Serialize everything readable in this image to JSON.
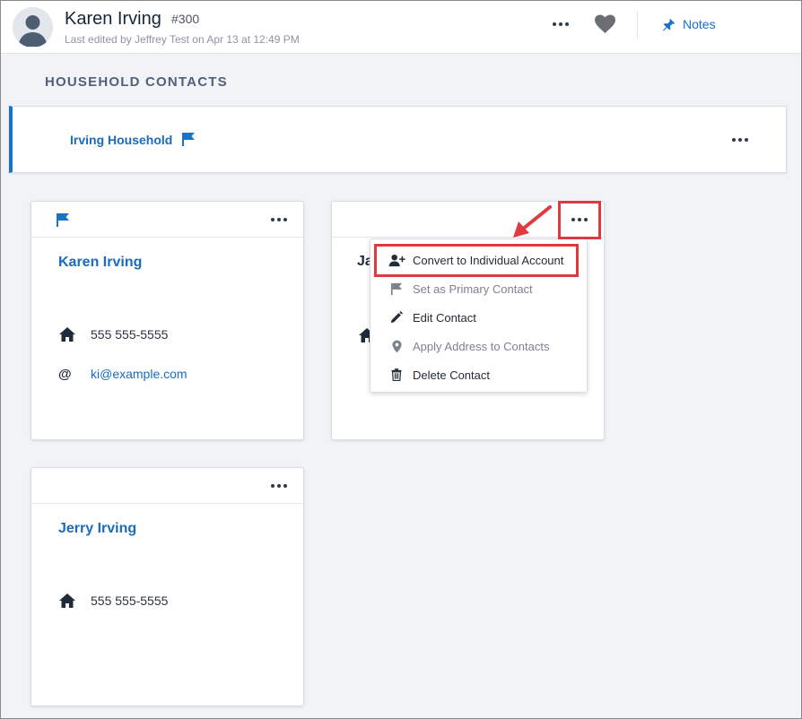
{
  "header": {
    "name": "Karen Irving",
    "record_id": "#300",
    "last_edited": "Last edited by Jeffrey Test on Apr 13 at 12:49 PM",
    "notes_label": "Notes"
  },
  "section_title": "HOUSEHOLD CONTACTS",
  "household": {
    "name": "Irving Household"
  },
  "cards": [
    {
      "name": "Karen Irving",
      "phone": "555 555-5555",
      "email": "ki@example.com"
    },
    {
      "name_partial": "Ja"
    },
    {
      "name": "Jerry Irving",
      "phone": "555 555-5555"
    }
  ],
  "menu": {
    "items": [
      {
        "label": "Convert to Individual Account",
        "icon": "person-add-icon",
        "enabled": true
      },
      {
        "label": "Set as Primary Contact",
        "icon": "flag-icon",
        "enabled": false
      },
      {
        "label": "Edit Contact",
        "icon": "pencil-icon",
        "enabled": true
      },
      {
        "label": "Apply Address to Contacts",
        "icon": "map-pin-icon",
        "enabled": false
      },
      {
        "label": "Delete Contact",
        "icon": "trash-icon",
        "enabled": true
      }
    ]
  },
  "colors": {
    "accent": "#1b6bbd",
    "annotation": "#e03a3e"
  }
}
